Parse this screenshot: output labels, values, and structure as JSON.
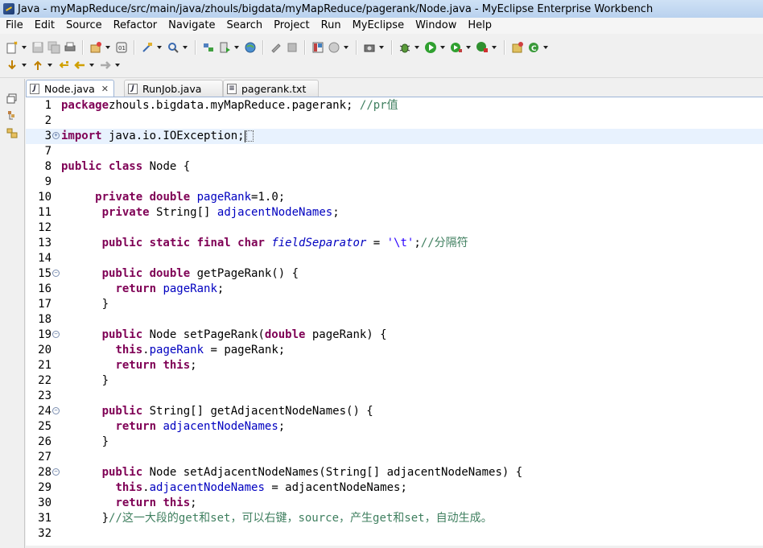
{
  "window": {
    "title": "Java - myMapReduce/src/main/java/zhouls/bigdata/myMapReduce/pagerank/Node.java - MyEclipse Enterprise Workbench"
  },
  "menu": [
    "File",
    "Edit",
    "Source",
    "Refactor",
    "Navigate",
    "Search",
    "Project",
    "Run",
    "MyEclipse",
    "Window",
    "Help"
  ],
  "tabs": [
    {
      "label": "Node.java",
      "active": true,
      "close": "✕"
    },
    {
      "label": "RunJob.java",
      "active": false
    },
    {
      "label": "pagerank.txt",
      "active": false
    }
  ],
  "editor": {
    "lines": [
      {
        "n": "1",
        "t": [
          [
            "kw",
            "package"
          ],
          [
            "",
            "zhouls.bigdata.myMapReduce.pagerank;"
          ],
          [
            "",
            " "
          ],
          [
            "cmt",
            "//pr值"
          ]
        ]
      },
      {
        "n": "2",
        "t": []
      },
      {
        "n": "3",
        "t": [
          [
            "kw",
            "import"
          ],
          [
            "",
            " java.io.IOException;"
          ]
        ],
        "fold": "+",
        "current": true,
        "caret": true
      },
      {
        "n": "7",
        "t": []
      },
      {
        "n": "8",
        "t": [
          [
            "kw",
            "public class"
          ],
          [
            "",
            " Node {"
          ]
        ]
      },
      {
        "n": "9",
        "t": []
      },
      {
        "n": "10",
        "t": [
          [
            "",
            "     "
          ],
          [
            "kw",
            "private double"
          ],
          [
            "",
            " "
          ],
          [
            "fld",
            "pageRank"
          ],
          [
            "",
            "=1.0;"
          ]
        ]
      },
      {
        "n": "11",
        "t": [
          [
            "",
            "      "
          ],
          [
            "kw",
            "private"
          ],
          [
            "",
            " String[] "
          ],
          [
            "fld",
            "adjacentNodeNames"
          ],
          [
            "",
            ";"
          ]
        ]
      },
      {
        "n": "12",
        "t": []
      },
      {
        "n": "13",
        "t": [
          [
            "",
            "      "
          ],
          [
            "kw",
            "public static final char"
          ],
          [
            "",
            " "
          ],
          [
            "sfld",
            "fieldSeparator"
          ],
          [
            "",
            " = "
          ],
          [
            "str",
            "'\\t'"
          ],
          [
            "",
            ";"
          ],
          [
            "cmt",
            "//分隔符"
          ]
        ]
      },
      {
        "n": "14",
        "t": []
      },
      {
        "n": "15",
        "t": [
          [
            "",
            "      "
          ],
          [
            "kw",
            "public double"
          ],
          [
            "",
            " getPageRank() {"
          ]
        ],
        "fold": "-"
      },
      {
        "n": "16",
        "t": [
          [
            "",
            "        "
          ],
          [
            "kw",
            "return"
          ],
          [
            "",
            " "
          ],
          [
            "fld",
            "pageRank"
          ],
          [
            "",
            ";"
          ]
        ]
      },
      {
        "n": "17",
        "t": [
          [
            "",
            "      }"
          ]
        ]
      },
      {
        "n": "18",
        "t": []
      },
      {
        "n": "19",
        "t": [
          [
            "",
            "      "
          ],
          [
            "kw",
            "public"
          ],
          [
            "",
            " Node setPageRank("
          ],
          [
            "kw",
            "double"
          ],
          [
            "",
            " pageRank) {"
          ]
        ],
        "fold": "-"
      },
      {
        "n": "20",
        "t": [
          [
            "",
            "        "
          ],
          [
            "kw",
            "this"
          ],
          [
            "",
            "."
          ],
          [
            "fld",
            "pageRank"
          ],
          [
            "",
            " = pageRank;"
          ]
        ]
      },
      {
        "n": "21",
        "t": [
          [
            "",
            "        "
          ],
          [
            "kw",
            "return this"
          ],
          [
            "",
            ";"
          ]
        ]
      },
      {
        "n": "22",
        "t": [
          [
            "",
            "      }"
          ]
        ]
      },
      {
        "n": "23",
        "t": []
      },
      {
        "n": "24",
        "t": [
          [
            "",
            "      "
          ],
          [
            "kw",
            "public"
          ],
          [
            "",
            " String[] getAdjacentNodeNames() {"
          ]
        ],
        "fold": "-"
      },
      {
        "n": "25",
        "t": [
          [
            "",
            "        "
          ],
          [
            "kw",
            "return"
          ],
          [
            "",
            " "
          ],
          [
            "fld",
            "adjacentNodeNames"
          ],
          [
            "",
            ";"
          ]
        ]
      },
      {
        "n": "26",
        "t": [
          [
            "",
            "      }"
          ]
        ]
      },
      {
        "n": "27",
        "t": []
      },
      {
        "n": "28",
        "t": [
          [
            "",
            "      "
          ],
          [
            "kw",
            "public"
          ],
          [
            "",
            " Node setAdjacentNodeNames(String[] adjacentNodeNames) {"
          ]
        ],
        "fold": "-"
      },
      {
        "n": "29",
        "t": [
          [
            "",
            "        "
          ],
          [
            "kw",
            "this"
          ],
          [
            "",
            "."
          ],
          [
            "fld",
            "adjacentNodeNames"
          ],
          [
            "",
            " = adjacentNodeNames;"
          ]
        ]
      },
      {
        "n": "30",
        "t": [
          [
            "",
            "        "
          ],
          [
            "kw",
            "return this"
          ],
          [
            "",
            ";"
          ]
        ]
      },
      {
        "n": "31",
        "t": [
          [
            "",
            "      }"
          ],
          [
            "cmt",
            "//这一大段的get和set，可以右键，source，产生get和set，自动生成。"
          ]
        ]
      },
      {
        "n": "32",
        "t": []
      }
    ]
  },
  "colors": {
    "keyword": "#7f0055",
    "field": "#0000c0",
    "string": "#2a00ff",
    "comment": "#3f7f5f",
    "current_line": "#e8f2fe"
  }
}
